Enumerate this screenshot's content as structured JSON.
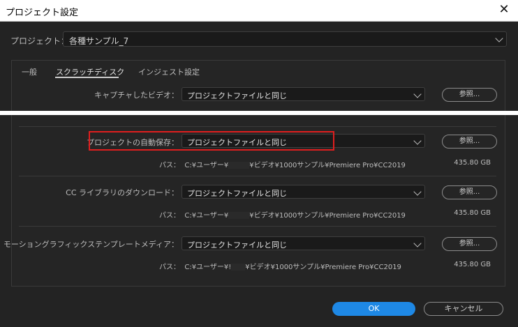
{
  "window": {
    "title": "プロジェクト設定",
    "close_symbol": "✕"
  },
  "project": {
    "label": "プロジェクト：",
    "value": "各種サンプル_7"
  },
  "tabs": [
    {
      "label": "一般"
    },
    {
      "label": "スクラッチディスク",
      "active": true
    },
    {
      "label": "インジェスト設定"
    }
  ],
  "rows": {
    "capture_video": {
      "label": "キャプチャしたビデオ：",
      "value": "プロジェクトファイルと同じ",
      "browse": "参照..."
    },
    "auto_save": {
      "label": "プロジェクトの自動保存：",
      "value": "プロジェクトファイルと同じ",
      "browse": "参照...",
      "path_label": "パス：",
      "path_before": "C:¥ユーザー¥",
      "path_after": "¥ビデオ¥1000サンプル¥Premiere Pro¥CC2019",
      "size": "435.80 GB"
    },
    "cc_library": {
      "label": "CC ライブラリのダウンロード：",
      "value": "プロジェクトファイルと同じ",
      "browse": "参照...",
      "path_label": "パス：",
      "path_before": "C:¥ユーザー¥",
      "path_after": "¥ビデオ¥1000サンプル¥Premiere Pro¥CC2019",
      "size": "435.80 GB"
    },
    "motion_graphics": {
      "label": "モーショングラフィックステンプレートメディア：",
      "value": "プロジェクトファイルと同じ",
      "browse": "参照...",
      "path_label": "パス：",
      "path_before": "C:¥ユーザー¥!",
      "path_after": "¥ビデオ¥1000サンプル¥Premiere Pro¥CC2019",
      "size": "435.80 GB"
    }
  },
  "buttons": {
    "ok": "OK",
    "cancel": "キャンセル"
  },
  "colors": {
    "accent": "#1e88e5",
    "highlight": "#e01e1e"
  }
}
